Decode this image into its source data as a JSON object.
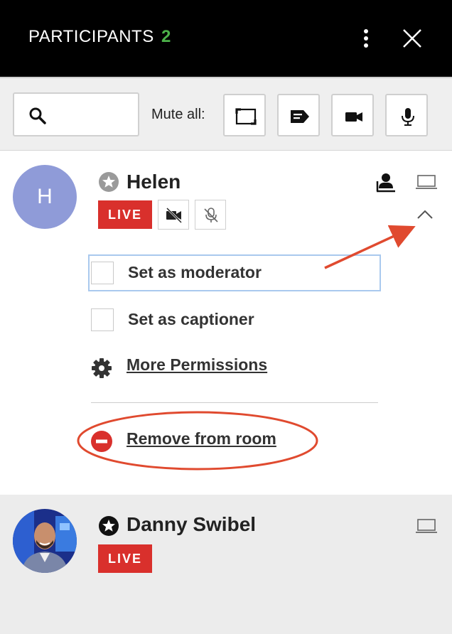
{
  "header": {
    "title": "PARTICIPANTS",
    "count": "2",
    "count_color": "#4cb24a"
  },
  "toolbar": {
    "search_placeholder": "",
    "mute_all_label": "Mute all:",
    "buttons": [
      {
        "icon": "screen-share-icon"
      },
      {
        "icon": "captions-icon"
      },
      {
        "icon": "video-camera-icon"
      },
      {
        "icon": "microphone-icon"
      }
    ]
  },
  "participants": [
    {
      "initial": "H",
      "name": "Helen",
      "live_label": "LIVE",
      "avatar_color": "#8f9bd8",
      "expanded": true,
      "options": {
        "moderator_label": "Set as moderator",
        "captioner_label": "Set as captioner",
        "permissions_label": "More Permissions",
        "remove_label": "Remove from room"
      }
    },
    {
      "name": "Danny Swibel",
      "live_label": "LIVE",
      "expanded": false
    }
  ],
  "colors": {
    "live": "#d9302c",
    "annotation": "#e04a2f"
  }
}
